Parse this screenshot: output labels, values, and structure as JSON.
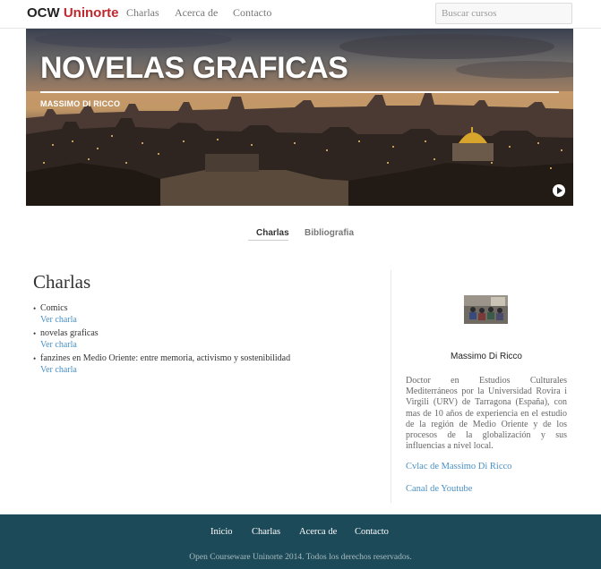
{
  "navbar": {
    "brand_prefix": "OCW",
    "brand_name": "Uninorte",
    "links": [
      "Charlas",
      "Acerca de",
      "Contacto"
    ],
    "search_placeholder": "Buscar cursos"
  },
  "hero": {
    "title": "NOVELAS GRAFICAS",
    "subtitle": "MASSIMO DI RICCO",
    "play_icon": "play-icon"
  },
  "tabs": {
    "items": [
      "Charlas",
      "Bibliografia"
    ],
    "active": "Charlas"
  },
  "main": {
    "heading": "Charlas",
    "talks": [
      {
        "title": "Comics",
        "link": "Ver charla"
      },
      {
        "title": "novelas graficas",
        "link": "Ver charla"
      },
      {
        "title": "fanzines en Medio Oriente: entre memoria, activismo y sostenibilidad",
        "link": "Ver charla"
      }
    ]
  },
  "sidebar": {
    "author_name": "Massimo Di Ricco",
    "bio": "Doctor en Estudios Culturales Mediterráneos por la Universidad Rovira i Virgili (URV) de Tarragona (España), con mas de 10 años de experiencia en el estudio de la región de Medio Oriente y de los procesos de la globalización y sus influencias a nivel local.",
    "links": [
      "Cvlac de Massimo Di Ricco",
      "Canal de Youtube"
    ]
  },
  "footer": {
    "links": [
      "Inicio",
      "Charlas",
      "Acerca de",
      "Contacto"
    ],
    "copyright": "Open Courseware Uninorte 2014. Todos los derechos reservados."
  },
  "colors": {
    "brand_red": "#c0282e",
    "link_blue": "#4a90c4",
    "footer_bg": "#1d4a58"
  }
}
